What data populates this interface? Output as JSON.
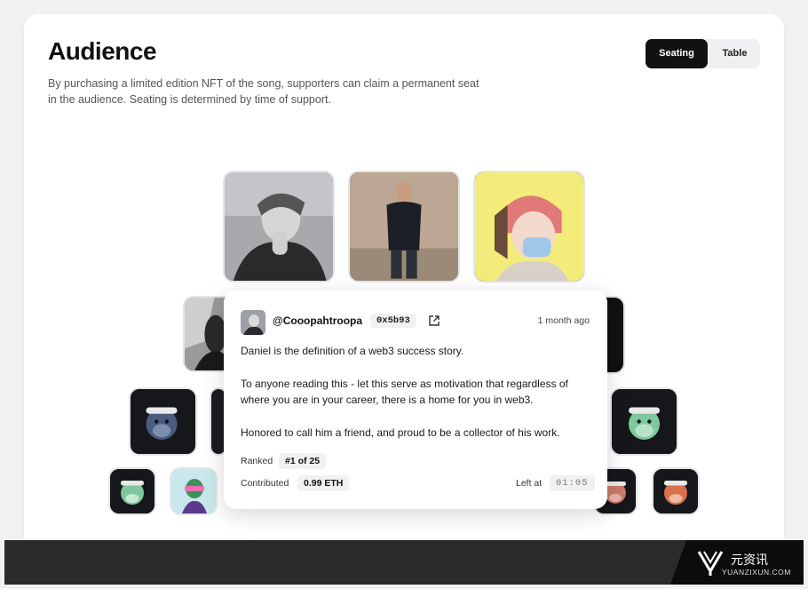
{
  "header": {
    "title": "Audience",
    "description": "By purchasing a limited edition NFT of the song, supporters can claim a permanent seat in the audience. Seating is determined by time of support."
  },
  "view_toggle": {
    "options": [
      "Seating",
      "Table"
    ],
    "selected": "Seating"
  },
  "seats": {
    "row1": [
      "photo-man-bw",
      "photo-man-standing",
      "nft-punk-mask"
    ],
    "row2": [
      "photo-bw-left",
      "dark-right"
    ],
    "row3": [
      "ape-blue",
      "ape-dark",
      "ape-green"
    ],
    "row4": [
      "ape-green-small",
      "nft-vr-girl",
      "ape-red",
      "ape-orange"
    ]
  },
  "supporter_popup": {
    "username": "@Cooopahtroopa",
    "address": "0x5b93",
    "time_ago": "1 month ago",
    "message": [
      "Daniel is the definition of a web3 success story.",
      "To anyone reading this - let this serve as motivation that regardless of where you are in your career, there is a home for you in web3.",
      "Honored to call him a friend, and proud to be a collector of his work."
    ],
    "ranked_label": "Ranked",
    "rank": "#1 of 25",
    "contributed_label": "Contributed",
    "contributed": "0.99 ETH",
    "left_at_label": "Left at",
    "left_at": "01:05"
  },
  "watermark": {
    "cn": "元资讯",
    "en": "YUANZIXUN.COM"
  },
  "colors": {
    "accent": "#111111",
    "card_bg": "#ffffff",
    "page_bg": "#f1f1f3",
    "pill_bg": "#f1f1f3"
  }
}
